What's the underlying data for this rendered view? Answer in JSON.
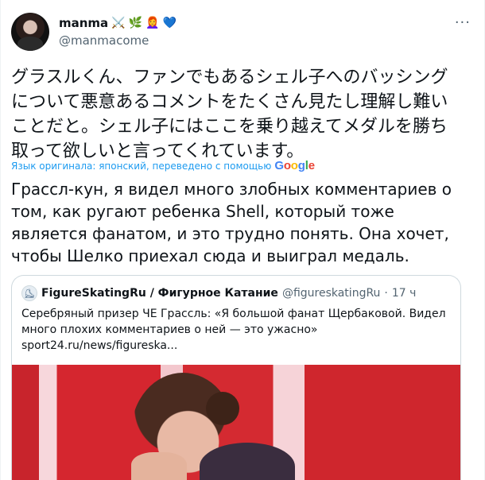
{
  "tweet": {
    "display_name": "manma",
    "emojis": [
      "⚔️",
      "🌿",
      "👩‍🦰",
      "💙"
    ],
    "handle": "@manmacome",
    "more_icon": "more-dots-icon",
    "original_text": "グラスルくん、ファンでもあるシェル子へのバッシングについて悪意あるコメントをたくさん見たし理解し難いことだと。シェル子にはここを乗り越えてメダルを勝ち取って欲しいと言ってくれています。",
    "translation_note": "Язык оригинала: японский, переведено с помощью",
    "translation_provider": "Google",
    "translated_text": "Грассл-кун, я видел много злобных комментариев о том, как ругают ребенка Shell, который тоже является фанатом, и это трудно понять. Она хочет, чтобы Шелко приехал сюда и выиграл медаль."
  },
  "quoted": {
    "name": "FigureSkatingRu / Фигурное Катание",
    "handle": "@figureskatingRu",
    "separator": "·",
    "time": "17 ч",
    "text": "Серебряный призер ЧЕ Грассль: «Я большой фанат Щербаковой. Видел много плохих комментариев о ней — это ужасно»",
    "link": "sport24.ru/news/figureska..."
  },
  "colors": {
    "link_blue": "#1d9bf0",
    "google_blue": "#4285F4",
    "google_red": "#EA4335",
    "google_yellow": "#FBBC05",
    "google_green": "#34A853",
    "secondary_text": "#536471"
  }
}
